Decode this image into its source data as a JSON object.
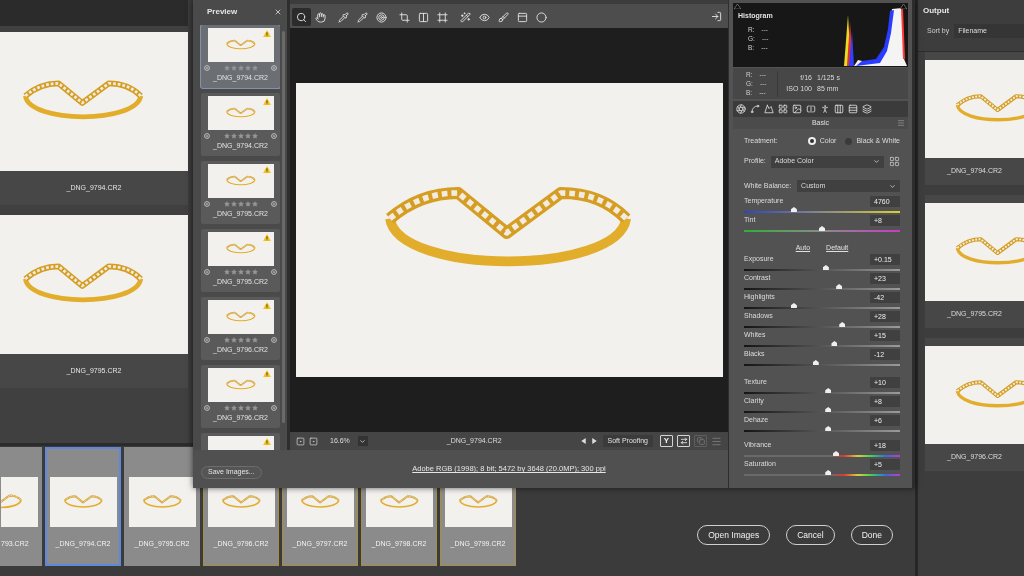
{
  "background": {
    "grid": [
      {
        "label": "_DNG_9794.CR2"
      },
      {
        "label": "_DNG_9795.CR2"
      }
    ],
    "filmstrip": [
      {
        "label": "793.CR2",
        "selected": false,
        "highlighted": false
      },
      {
        "label": "_DNG_9794.CR2",
        "selected": true,
        "highlighted": false
      },
      {
        "label": "_DNG_9795.CR2",
        "selected": false,
        "highlighted": false
      },
      {
        "label": "_DNG_9796.CR2",
        "selected": false,
        "highlighted": true
      },
      {
        "label": "_DNG_9797.CR2",
        "selected": false,
        "highlighted": true
      },
      {
        "label": "_DNG_9798.CR2",
        "selected": false,
        "highlighted": true
      },
      {
        "label": "_DNG_9799.CR2",
        "selected": false,
        "highlighted": true
      }
    ],
    "buttons": [
      "Open Images",
      "Cancel",
      "Done"
    ]
  },
  "output": {
    "title": "Output",
    "sort_label": "Sort by",
    "sort_value": "Filename",
    "items": [
      {
        "label": "_DNG_9794.CR2"
      },
      {
        "label": "_DNG_9795.CR2"
      },
      {
        "label": "_DNG_9796.CR2"
      }
    ]
  },
  "dialog": {
    "preview": {
      "title": "Preview",
      "items": [
        {
          "label": "_DNG_9794.CR2",
          "selected": true,
          "warning": true,
          "stars": 0
        },
        {
          "label": "_DNG_9794.CR2",
          "selected": false,
          "warning": true,
          "stars": 0
        },
        {
          "label": "_DNG_9795.CR2",
          "selected": false,
          "warning": true,
          "stars": 0
        },
        {
          "label": "_DNG_9795.CR2",
          "selected": false,
          "warning": true,
          "stars": 0
        },
        {
          "label": "_DNG_9796.CR2",
          "selected": false,
          "warning": true,
          "stars": 0
        },
        {
          "label": "_DNG_9796.CR2",
          "selected": false,
          "warning": true,
          "stars": 0
        },
        {
          "selected": false,
          "warning": true
        }
      ],
      "save_button": "Save Images..."
    },
    "toolbar": {
      "groups": [
        {
          "tools": [
            {
              "kind": "zoom",
              "selected": true
            },
            {
              "kind": "hand",
              "selected": false
            }
          ]
        },
        {
          "tools": [
            {
              "kind": "white-balance",
              "selected": false
            },
            {
              "kind": "color-sampler",
              "selected": false
            },
            {
              "kind": "targeted-adjustment",
              "selected": false
            }
          ]
        },
        {
          "tools": [
            {
              "kind": "crop",
              "selected": false
            },
            {
              "kind": "straighten",
              "selected": false
            },
            {
              "kind": "transform",
              "selected": false
            }
          ]
        },
        {
          "tools": [
            {
              "kind": "spot-removal",
              "selected": false
            },
            {
              "kind": "red-eye",
              "selected": false
            },
            {
              "kind": "brush",
              "selected": false
            },
            {
              "kind": "graduated-filter",
              "selected": false
            },
            {
              "kind": "radial-filter",
              "selected": false
            }
          ]
        }
      ]
    },
    "status_bar": {
      "zoom": "16.6%",
      "filename": "_DNG_9794.CR2",
      "soft_proofing": "Soft Proofing",
      "view_buttons": [
        {
          "kind": "text",
          "label": "Y",
          "disabled": false
        },
        {
          "kind": "swap",
          "disabled": false
        },
        {
          "kind": "copy",
          "disabled": true
        },
        {
          "kind": "menu",
          "disabled": true
        }
      ]
    },
    "info_link": "Adobe RGB (1998); 8 bit; 5472 by 3648 (20.0MP); 300 ppi",
    "panel": {
      "histogram": {
        "title": "Histogram",
        "readout": [
          {
            "channel": "R:",
            "value": "---"
          },
          {
            "channel": "G:",
            "value": "---"
          },
          {
            "channel": "B:",
            "value": "---"
          }
        ]
      },
      "info": {
        "readout": [
          {
            "channel": "R:",
            "value": "---"
          },
          {
            "channel": "G:",
            "value": "---"
          },
          {
            "channel": "B:",
            "value": "---"
          }
        ],
        "aperture": "f/16",
        "shutter": "1/125 s",
        "iso": "ISO 100",
        "focal_length": "85 mm"
      },
      "title": "Basic",
      "treatment": {
        "label": "Treatment:",
        "options": [
          {
            "label": "Color",
            "selected": true
          },
          {
            "label": "Black & White",
            "selected": false
          }
        ]
      },
      "profile": {
        "label": "Profile:",
        "value": "Adobe Color"
      },
      "white_balance": {
        "label": "White Balance:",
        "value": "Custom"
      },
      "wb_sliders": [
        {
          "label": "Temperature",
          "value": "4760",
          "level": 0.32,
          "kind": "temperature"
        },
        {
          "label": "Tint",
          "value": "+8",
          "level": 0.5,
          "kind": "tint"
        }
      ],
      "links": [
        "Auto",
        "Default"
      ],
      "tone_sliders": [
        {
          "label": "Exposure",
          "value": "+0.15",
          "level": 0.525,
          "kind": "tone"
        },
        {
          "label": "Contrast",
          "value": "+23",
          "level": 0.61,
          "kind": "tone"
        },
        {
          "label": "Highlights",
          "value": "-42",
          "level": 0.32,
          "kind": "tone"
        },
        {
          "label": "Shadows",
          "value": "+28",
          "level": 0.63,
          "kind": "tone"
        },
        {
          "label": "Whites",
          "value": "+15",
          "level": 0.58,
          "kind": "tone"
        },
        {
          "label": "Blacks",
          "value": "-12",
          "level": 0.46,
          "kind": "tone"
        }
      ],
      "presence_sliders": [
        {
          "label": "Texture",
          "value": "+10",
          "level": 0.54,
          "kind": "tone"
        },
        {
          "label": "Clarity",
          "value": "+8",
          "level": 0.54,
          "kind": "tone"
        },
        {
          "label": "Dehaze",
          "value": "+6",
          "level": 0.54,
          "kind": "tone"
        }
      ],
      "color_sliders": [
        {
          "label": "Vibrance",
          "value": "+18",
          "level": 0.59,
          "kind": "color"
        },
        {
          "label": "Saturation",
          "value": "+5",
          "level": 0.54,
          "kind": "color"
        }
      ]
    }
  }
}
